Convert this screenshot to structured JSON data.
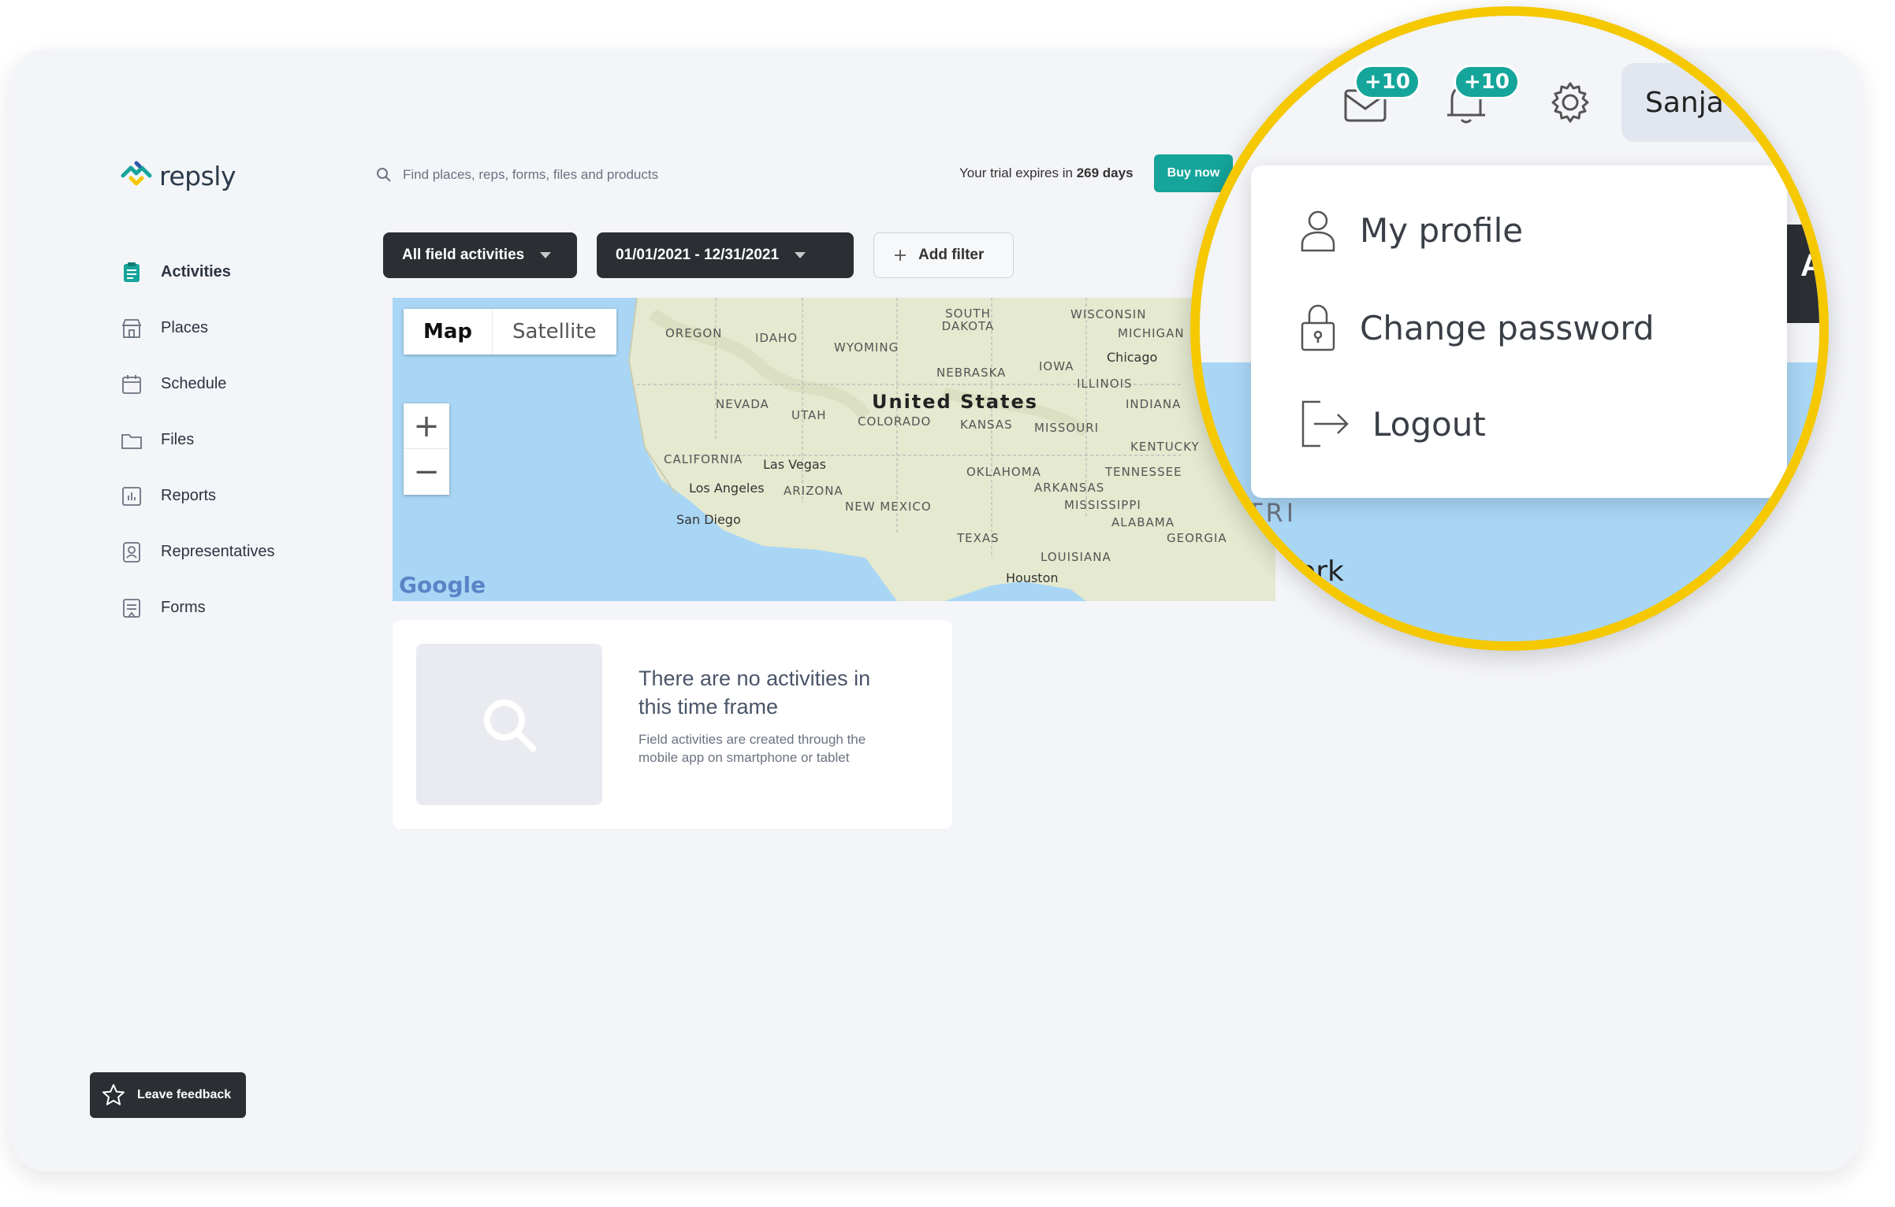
{
  "brand": {
    "name": "repsly",
    "accent": "#15a59a",
    "dark": "#2b2e33",
    "highlight": "#f5c800"
  },
  "header": {
    "search_placeholder": "Find places, reps, forms, files and products",
    "trial_prefix": "Your trial expires in",
    "trial_days": "269 days",
    "buy_label": "Buy now"
  },
  "sidebar": {
    "items": [
      {
        "label": "Activities",
        "icon": "clipboard-icon",
        "active": true
      },
      {
        "label": "Places",
        "icon": "store-icon"
      },
      {
        "label": "Schedule",
        "icon": "calendar-icon"
      },
      {
        "label": "Files",
        "icon": "folder-icon"
      },
      {
        "label": "Reports",
        "icon": "chart-icon"
      },
      {
        "label": "Representatives",
        "icon": "person-badge-icon"
      },
      {
        "label": "Forms",
        "icon": "form-icon"
      }
    ]
  },
  "filters": {
    "activity_type": "All field activities",
    "date_range": "01/01/2021 - 12/31/2021",
    "add_filter": "Add filter"
  },
  "map": {
    "map_tab": "Map",
    "satellite_tab": "Satellite",
    "zoom_in": "+",
    "zoom_out": "−",
    "attribution": "Google",
    "labels": {
      "country": "United States",
      "oregon": "OREGON",
      "idaho": "IDAHO",
      "wyoming": "WYOMING",
      "south_dakota": "SOUTH DAKOTA",
      "wisconsin": "WISCONSIN",
      "michigan": "MICHIGAN",
      "nebraska": "NEBRASKA",
      "iowa": "IOWA",
      "illinois": "ILLINOIS",
      "indiana": "INDIANA",
      "nevada": "NEVADA",
      "utah": "UTAH",
      "colorado": "COLORADO",
      "kansas": "KANSAS",
      "missouri": "MISSOURI",
      "kentucky": "KENTUCKY",
      "california": "CALIFORNIA",
      "arizona": "ARIZONA",
      "new_mexico": "NEW MEXICO",
      "oklahoma": "OKLAHOMA",
      "arkansas": "ARKANSAS",
      "tennessee": "TENNESSEE",
      "mississippi": "MISSISSIPPI",
      "alabama": "ALABAMA",
      "georgia": "GEORGIA",
      "texas": "TEXAS",
      "louisiana": "LOUISIANA",
      "chicago": "Chicago",
      "las_vegas": "Las Vegas",
      "los_angeles": "Los Angeles",
      "san_diego": "San Diego",
      "houston": "Houston"
    }
  },
  "empty_state": {
    "title": "There are no activities in this time frame",
    "subtitle": "Field activities are created through the mobile app on smartphone or tablet"
  },
  "feedback": {
    "label": "Leave feedback"
  },
  "zoom_callout": {
    "messages_badge": "+10",
    "notifications_badge": "+10",
    "user_name": "Sanja",
    "partial_letter": "A",
    "map_fragment_1": "TRI",
    "map_fragment_2": "York",
    "menu": [
      {
        "label": "My profile",
        "icon": "user-icon"
      },
      {
        "label": "Change password",
        "icon": "lock-icon"
      },
      {
        "label": "Logout",
        "icon": "logout-icon"
      }
    ]
  }
}
